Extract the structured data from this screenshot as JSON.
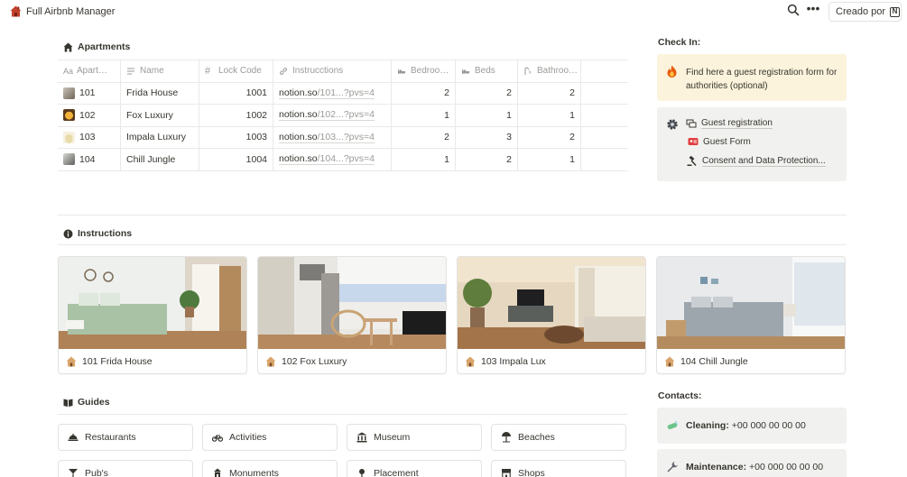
{
  "topbar": {
    "title": "Full Airbnb Manager",
    "created_by_label": "Creado por",
    "more_label": "•••"
  },
  "apartments": {
    "title": "Apartments",
    "columns": [
      "Apart…",
      "Name",
      "Lock Code",
      "Instrucctions",
      "Bedroo…",
      "Beds",
      "Bathroo…"
    ],
    "rows": [
      {
        "apartment": "101",
        "name": "Frida House",
        "lock_code": "1001",
        "url_main": "notion.so",
        "url_fade": "/101...?pvs=4",
        "bedrooms": "2",
        "beds": "2",
        "bathrooms": "2"
      },
      {
        "apartment": "102",
        "name": "Fox Luxury",
        "lock_code": "1002",
        "url_main": "notion.so",
        "url_fade": "/102...?pvs=4",
        "bedrooms": "1",
        "beds": "1",
        "bathrooms": "1"
      },
      {
        "apartment": "103",
        "name": "Impala Luxury",
        "lock_code": "1003",
        "url_main": "notion.so",
        "url_fade": "/103...?pvs=4",
        "bedrooms": "2",
        "beds": "3",
        "bathrooms": "2"
      },
      {
        "apartment": "104",
        "name": "Chill Jungle",
        "lock_code": "1004",
        "url_main": "notion.so",
        "url_fade": "/104...?pvs=4",
        "bedrooms": "1",
        "beds": "2",
        "bathrooms": "1"
      }
    ]
  },
  "check_in": {
    "title": "Check In:",
    "callout_text": "Find here a guest registration form for authorities (optional)",
    "items": [
      "Guest registration",
      "Guest Form",
      "Consent and Data Protection..."
    ]
  },
  "instructions": {
    "title": "Instructions",
    "cards": [
      "101 Frida House",
      "102 Fox Luxury",
      "103 Impala Lux",
      "104 Chill Jungle"
    ]
  },
  "guides": {
    "title": "Guides",
    "buttons": [
      "Restaurants",
      "Activities",
      "Museum",
      "Beaches",
      "Pub's",
      "Monuments",
      "Placement",
      "Shops"
    ]
  },
  "contacts": {
    "title": "Contacts:",
    "items": [
      {
        "role": "Cleaning:",
        "phone": "+00 000 00 00 00"
      },
      {
        "role": "Maintenance:",
        "phone": "+00 000 00 00 00"
      }
    ]
  },
  "colors": {
    "callout_yellow": "#fbf3db",
    "callout_gray": "#f1f1ef",
    "text": "#37352f",
    "muted": "#9b9a97"
  }
}
